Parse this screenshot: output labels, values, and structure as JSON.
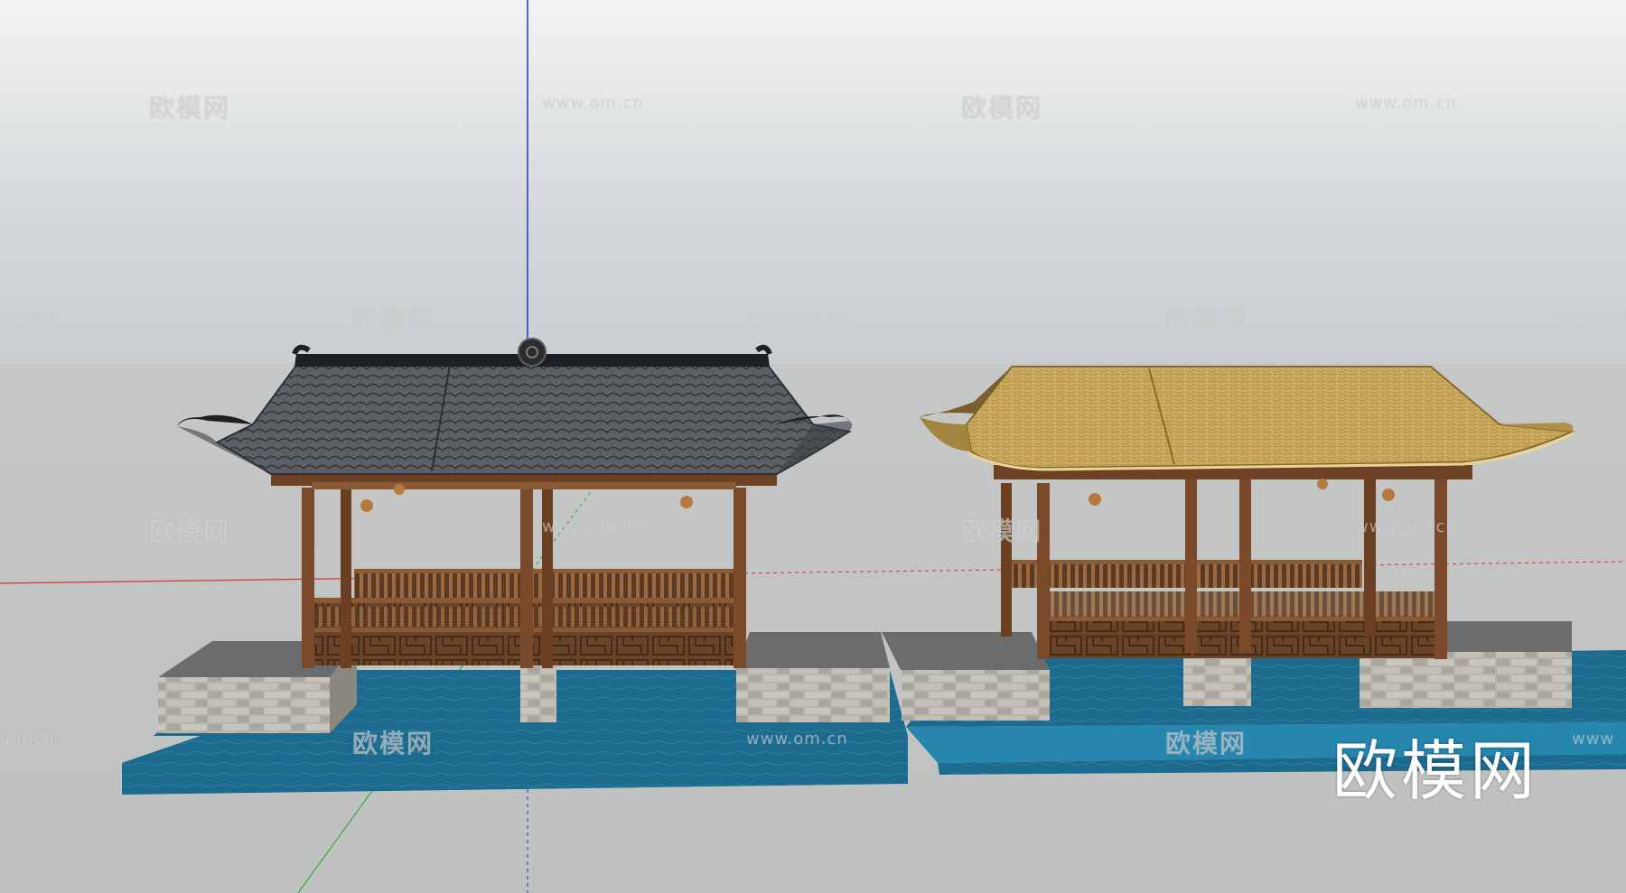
{
  "watermarks": [
    {
      "text": "欧模网",
      "kind": "logo"
    },
    {
      "text": "www.om.cn",
      "kind": "url"
    },
    {
      "text": "欧模网",
      "kind": "logo"
    },
    {
      "text": "www.om.cn",
      "kind": "url"
    },
    {
      "text": "om.cn",
      "kind": "url"
    },
    {
      "text": "欧模网",
      "kind": "logo"
    },
    {
      "text": "www.om.cn",
      "kind": "url"
    },
    {
      "text": "欧模网",
      "kind": "logo"
    },
    {
      "text": "www.om.cn",
      "kind": "url"
    },
    {
      "text": "欧模网",
      "kind": "logo"
    },
    {
      "text": "www.om.cn",
      "kind": "url"
    },
    {
      "text": "欧模网",
      "kind": "logo"
    },
    {
      "text": "www.om.cn",
      "kind": "url"
    },
    {
      "text": "om.cn",
      "kind": "url"
    },
    {
      "text": "欧模网",
      "kind": "logo"
    },
    {
      "text": "www.om.cn",
      "kind": "url"
    },
    {
      "text": "欧模网",
      "kind": "logo"
    },
    {
      "text": "www",
      "kind": "url"
    }
  ],
  "brand": "欧模网",
  "colors": {
    "tile_roof": "#5a5e62",
    "thatch_roof": "#c8a85a",
    "wood": "#7a4a2a",
    "water": "#1d6f93",
    "stone": "#b4b1aa",
    "axis_blue": "#2233dd",
    "axis_red": "#dd3333",
    "axis_green": "#33aa33"
  }
}
